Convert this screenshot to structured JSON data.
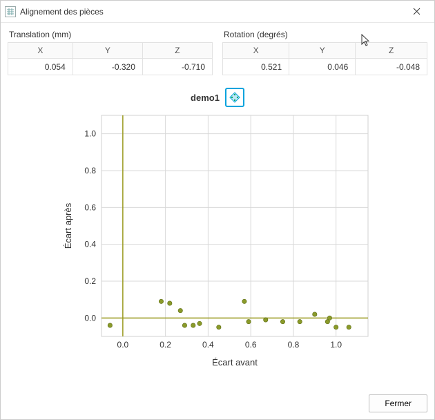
{
  "window": {
    "title": "Alignement des pièces"
  },
  "translation": {
    "caption": "Translation (mm)",
    "headers": {
      "x": "X",
      "y": "Y",
      "z": "Z"
    },
    "values": {
      "x": "0.054",
      "y": "-0.320",
      "z": "-0.710"
    }
  },
  "rotation": {
    "caption": "Rotation (degrés)",
    "headers": {
      "x": "X",
      "y": "Y",
      "z": "Z"
    },
    "values": {
      "x": "0.521",
      "y": "0.046",
      "z": "-0.048"
    }
  },
  "legend": {
    "series_name": "demo1"
  },
  "chart_data": {
    "type": "scatter",
    "title": "",
    "xlabel": "Écart avant",
    "ylabel": "Écart après",
    "xlim": [
      -0.1,
      1.15
    ],
    "ylim": [
      -0.1,
      1.1
    ],
    "xticks": [
      0.0,
      0.2,
      0.4,
      0.6,
      0.8,
      1.0
    ],
    "yticks": [
      0.0,
      0.2,
      0.4,
      0.6,
      0.8,
      1.0
    ],
    "series": [
      {
        "name": "demo1",
        "color": "#8a9a2a",
        "points": [
          {
            "x": -0.06,
            "y": -0.04
          },
          {
            "x": 0.18,
            "y": 0.09
          },
          {
            "x": 0.22,
            "y": 0.08
          },
          {
            "x": 0.27,
            "y": 0.04
          },
          {
            "x": 0.29,
            "y": -0.04
          },
          {
            "x": 0.33,
            "y": -0.04
          },
          {
            "x": 0.36,
            "y": -0.03
          },
          {
            "x": 0.45,
            "y": -0.05
          },
          {
            "x": 0.57,
            "y": 0.09
          },
          {
            "x": 0.59,
            "y": -0.02
          },
          {
            "x": 0.67,
            "y": -0.01
          },
          {
            "x": 0.75,
            "y": -0.02
          },
          {
            "x": 0.83,
            "y": -0.02
          },
          {
            "x": 0.9,
            "y": 0.02
          },
          {
            "x": 0.96,
            "y": -0.02
          },
          {
            "x": 0.97,
            "y": 0.0
          },
          {
            "x": 1.0,
            "y": -0.05
          },
          {
            "x": 1.06,
            "y": -0.05
          }
        ]
      }
    ]
  },
  "footer": {
    "close_label": "Fermer"
  }
}
